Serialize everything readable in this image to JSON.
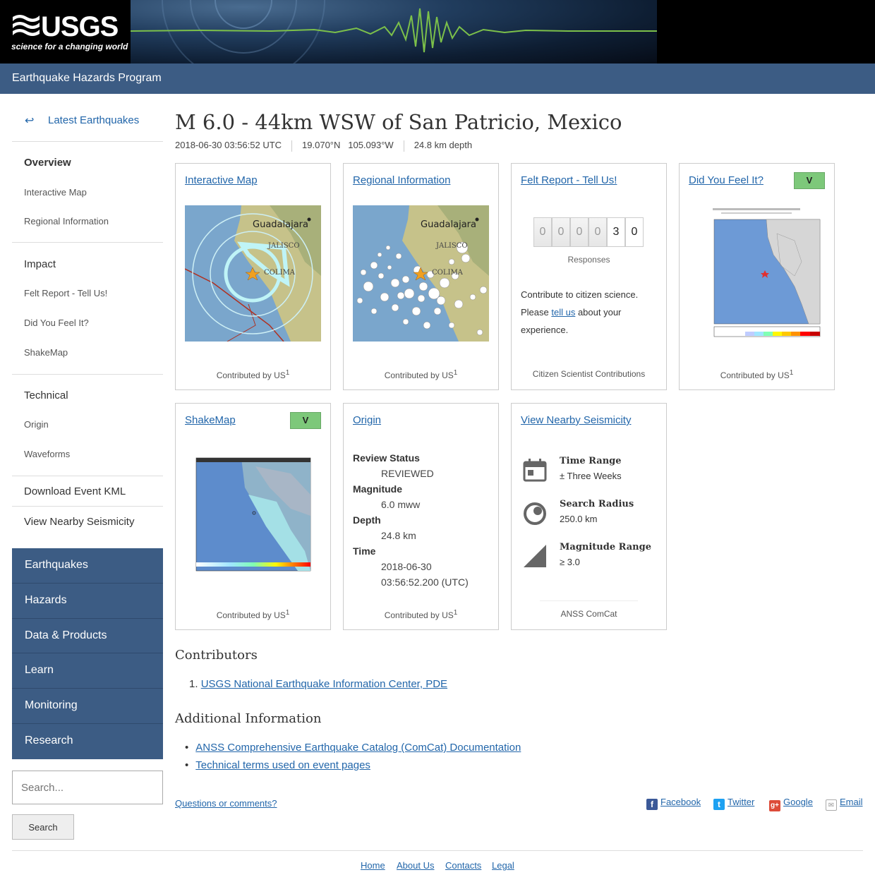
{
  "header": {
    "logo_text": "USGS",
    "logo_tagline": "science for a changing world",
    "program": "Earthquake Hazards Program"
  },
  "sidebar": {
    "back_label": "Latest Earthquakes",
    "items": [
      {
        "label": "Overview"
      },
      {
        "label": "Interactive Map"
      },
      {
        "label": "Regional Information"
      },
      {
        "label": "Impact"
      },
      {
        "label": "Felt Report - Tell Us!"
      },
      {
        "label": "Did You Feel It?"
      },
      {
        "label": "ShakeMap"
      },
      {
        "label": "Technical"
      },
      {
        "label": "Origin"
      },
      {
        "label": "Waveforms"
      },
      {
        "label": "Download Event KML"
      },
      {
        "label": "View Nearby Seismicity"
      }
    ],
    "main_nav": [
      "Earthquakes",
      "Hazards",
      "Data & Products",
      "Learn",
      "Monitoring",
      "Research"
    ],
    "search_placeholder": "Search...",
    "search_button": "Search"
  },
  "event": {
    "title": "M 6.0 - 44km WSW of San Patricio, Mexico",
    "time": "2018-06-30 03:56:52 UTC",
    "location": "19.070°N   105.093°W",
    "depth": "24.8 km depth"
  },
  "cards": {
    "interactive_map": {
      "title": "Interactive Map",
      "footer": "Contributed by US",
      "sup": "1",
      "label1": "Guadalajara",
      "label2": "JALISCO",
      "label3": "COLIMA"
    },
    "regional": {
      "title": "Regional Information",
      "footer": "Contributed by US",
      "sup": "1",
      "label1": "Guadalajara",
      "label2": "JALISCO",
      "label3": "COLIMA"
    },
    "felt": {
      "title": "Felt Report - Tell Us!",
      "digits": [
        "0",
        "0",
        "0",
        "0",
        "3",
        "0"
      ],
      "responses": "Responses",
      "text1": "Contribute to citizen science.",
      "text2": "Please ",
      "link": "tell us",
      "text3": " about your experience.",
      "footer": "Citizen Scientist Contributions"
    },
    "dyfi": {
      "title": "Did You Feel It?",
      "badge": "V",
      "footer": "Contributed by US",
      "sup": "1"
    },
    "shakemap": {
      "title": "ShakeMap",
      "badge": "V",
      "footer": "Contributed by US",
      "sup": "1"
    },
    "origin": {
      "title": "Origin",
      "rows": [
        {
          "k": "Review Status",
          "v": "REVIEWED"
        },
        {
          "k": "Magnitude",
          "v": "6.0 mww"
        },
        {
          "k": "Depth",
          "v": "24.8 km"
        },
        {
          "k": "Time",
          "v": "2018-06-30",
          "v2": "03:56:52.200 (UTC)"
        }
      ],
      "footer": "Contributed by US",
      "sup": "1"
    },
    "nearby": {
      "title": "View Nearby Seismicity",
      "rows": [
        {
          "k": "Time Range",
          "v": "± Three Weeks"
        },
        {
          "k": "Search Radius",
          "v": "250.0 km"
        },
        {
          "k": "Magnitude Range",
          "v": "≥ 3.0"
        }
      ],
      "footer": "ANSS ComCat"
    }
  },
  "contributors": {
    "heading": "Contributors",
    "number": "1.",
    "item": "USGS National Earthquake Information Center, PDE"
  },
  "additional": {
    "heading": "Additional Information",
    "items": [
      "ANSS Comprehensive Earthquake Catalog (ComCat) Documentation",
      "Technical terms used on event pages"
    ]
  },
  "footer": {
    "questions": "Questions or comments?",
    "social": [
      "Facebook",
      "Twitter",
      "Google",
      "Email"
    ],
    "links": [
      "Home",
      "About Us",
      "Contacts",
      "Legal"
    ]
  },
  "colors": {
    "accent": "#3c5c84",
    "link": "#2266aa",
    "badge": "#7dc87a"
  }
}
